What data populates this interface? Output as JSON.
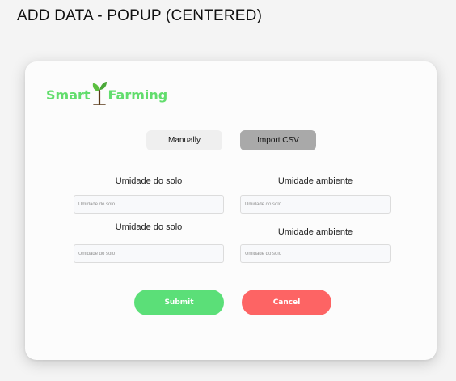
{
  "page": {
    "title": "ADD DATA - POPUP (CENTERED)"
  },
  "brand": {
    "name_left": "Smart",
    "name_right": "Farming",
    "color": "#62dd6d",
    "icon": "sprout-icon"
  },
  "tabs": {
    "manually": "Manually",
    "import_csv": "Import CSV",
    "selected": "Import CSV"
  },
  "fields": [
    {
      "label": "Umidade do solo",
      "placeholder": "Umidade do solo",
      "value": ""
    },
    {
      "label": "Umidade ambiente",
      "placeholder": "Umidade do solo",
      "value": ""
    },
    {
      "label": "Umidade do solo",
      "placeholder": "Umidade do solo",
      "value": ""
    },
    {
      "label": "Umidade ambiente",
      "placeholder": "Umidade do solo",
      "value": ""
    }
  ],
  "actions": {
    "submit_label": "Submit",
    "cancel_label": "Cancel",
    "submit_color": "#5bdf78",
    "cancel_color": "#fd6464"
  }
}
